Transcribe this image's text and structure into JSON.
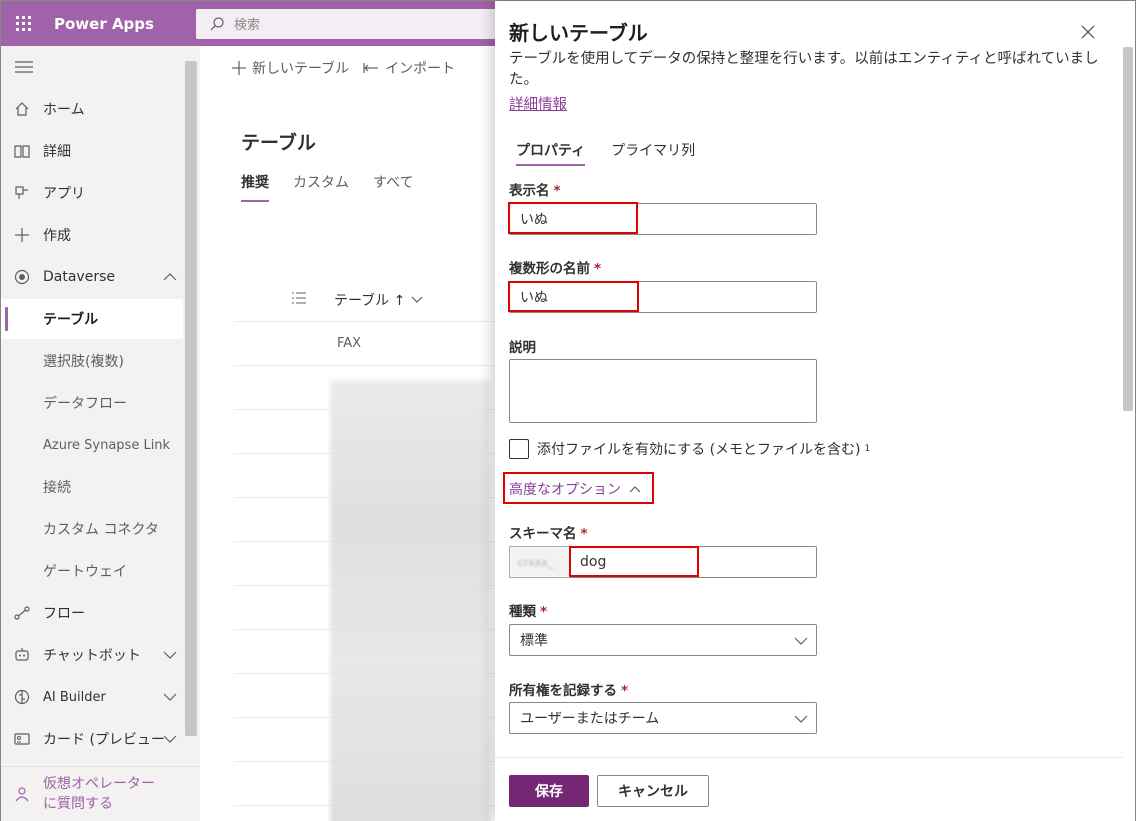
{
  "topbar": {
    "app_name": "Power Apps",
    "search_placeholder": "検索"
  },
  "nav": {
    "items": [
      {
        "label": "ホーム"
      },
      {
        "label": "詳細"
      },
      {
        "label": "アプリ"
      },
      {
        "label": "作成"
      },
      {
        "label": "Dataverse"
      },
      {
        "label": "テーブル"
      },
      {
        "label": "選択肢(複数)"
      },
      {
        "label": "データフロー"
      },
      {
        "label": "Azure Synapse Link"
      },
      {
        "label": "接続"
      },
      {
        "label": "カスタム コネクタ"
      },
      {
        "label": "ゲートウェイ"
      },
      {
        "label": "フロー"
      },
      {
        "label": "チャットボット"
      },
      {
        "label": "AI Builder"
      },
      {
        "label": "カード (プレビュー"
      }
    ],
    "bottom": {
      "line1": "仮想オペレーター",
      "line2": "に質問する"
    }
  },
  "commandbar": {
    "new_table": "新しいテーブル",
    "import": "インポート"
  },
  "main": {
    "title": "テーブル",
    "tabs": [
      {
        "label": "推奨"
      },
      {
        "label": "カスタム"
      },
      {
        "label": "すべて"
      }
    ],
    "grid_header": "テーブル ↑",
    "first_row": "FAX"
  },
  "panel": {
    "title": "新しいテーブル",
    "description": "テーブルを使用してデータの保持と整理を行います。以前はエンティティと呼ばれていました。",
    "learn_more": "詳細情報",
    "tabs": [
      {
        "label": "プロパティ"
      },
      {
        "label": "プライマリ列"
      }
    ],
    "fields": {
      "display_name": {
        "label": "表示名",
        "value": "いぬ"
      },
      "plural_name": {
        "label": "複数形の名前",
        "value": "いぬ"
      },
      "description": {
        "label": "説明",
        "value": ""
      },
      "attachments": {
        "label": "添付ファイルを有効にする (メモとファイルを含む)",
        "sup": "1"
      },
      "advanced": {
        "label": "高度なオプション"
      },
      "schema_name": {
        "label": "スキーマ名",
        "value": "dog"
      },
      "type": {
        "label": "種類",
        "value": "標準"
      },
      "ownership": {
        "label": "所有権を記録する",
        "value": "ユーザーまたはチーム"
      }
    },
    "required_mark": "*",
    "save": "保存",
    "cancel": "キャンセル"
  },
  "colors": {
    "brand": "#a062a8",
    "primary_button": "#742774",
    "link": "#8c3e9a",
    "highlight": "#e00000"
  }
}
